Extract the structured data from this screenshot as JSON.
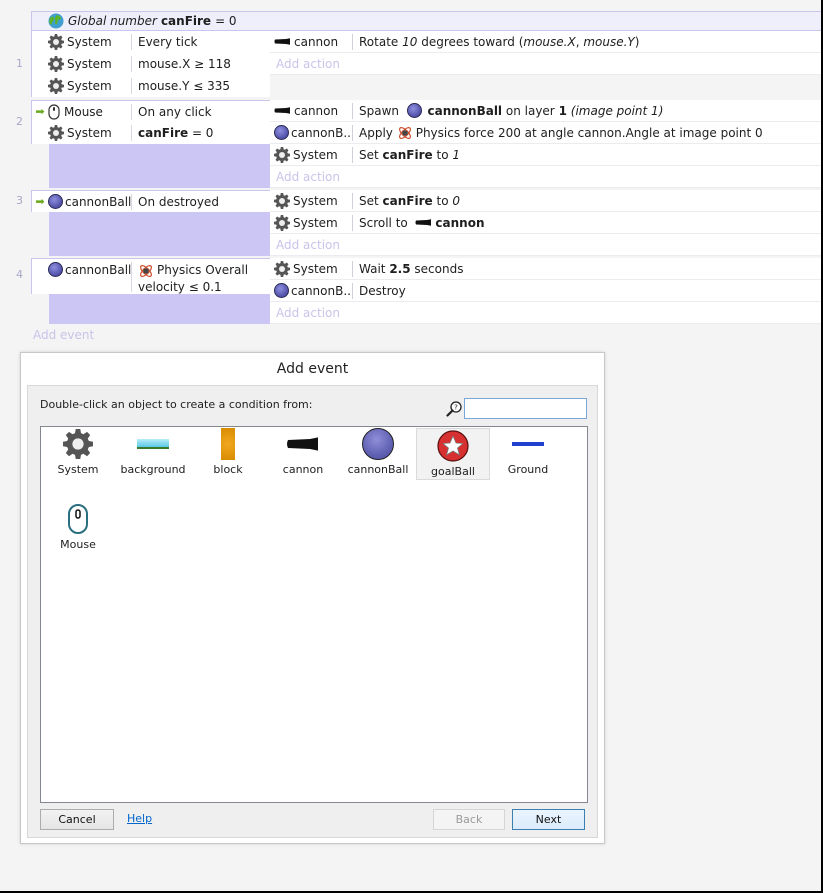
{
  "event_sheet": {
    "global_variable": {
      "prefix": "Global number",
      "name": "canFire",
      "suffix": "= 0",
      "icon": "globe-icon"
    },
    "events": [
      {
        "number": "1",
        "trigger": false,
        "conditions": [
          {
            "object": "System",
            "icon": "gear-icon",
            "text": "Every tick"
          },
          {
            "object": "System",
            "icon": "gear-icon",
            "text": "mouse.X ≥ 118"
          },
          {
            "object": "System",
            "icon": "gear-icon",
            "text": "mouse.Y ≤ 335"
          }
        ],
        "actions": [
          {
            "object": "cannon",
            "icon": "cannon-icon",
            "parts": [
              "Rotate ",
              "10",
              " degrees toward (",
              "mouse.X",
              ", ",
              "mouse.Y",
              ")"
            ]
          }
        ],
        "add_action": "Add action"
      },
      {
        "number": "2",
        "trigger": true,
        "conditions": [
          {
            "object": "Mouse",
            "icon": "mouse-icon",
            "text": "On any click"
          },
          {
            "object": "System",
            "icon": "gear-icon",
            "bold": "canFire",
            "text": " = 0"
          }
        ],
        "actions": [
          {
            "object": "cannon",
            "icon": "cannon-icon",
            "verb": "Spawn",
            "target": "cannonBall",
            "mid": "on layer",
            "layer": "1",
            "tail": "(image point 1)"
          },
          {
            "object": "cannonB...",
            "icon": "cannonball-icon",
            "verb": "Apply",
            "text": "Physics force 200 at angle cannon.Angle at image point 0"
          },
          {
            "object": "System",
            "icon": "gear-icon",
            "verb": "Set",
            "var": "canFire",
            "mid": "to",
            "value": "1"
          }
        ],
        "add_action": "Add action"
      },
      {
        "number": "3",
        "trigger": true,
        "conditions": [
          {
            "object": "cannonBall",
            "icon": "cannonball-icon",
            "text": "On destroyed"
          }
        ],
        "actions": [
          {
            "object": "System",
            "icon": "gear-icon",
            "verb": "Set",
            "var": "canFire",
            "mid": "to",
            "value": "0"
          },
          {
            "object": "System",
            "icon": "gear-icon",
            "verb": "Scroll to",
            "target": "cannon"
          }
        ],
        "add_action": "Add action"
      },
      {
        "number": "4",
        "trigger": false,
        "conditions": [
          {
            "object": "cannonBall",
            "icon": "cannonball-icon",
            "text": "Physics Overall velocity ≤ 0.1"
          }
        ],
        "actions": [
          {
            "object": "System",
            "icon": "gear-icon",
            "verb": "Wait",
            "value": "2.5",
            "tail": "seconds"
          },
          {
            "object": "cannonB...",
            "icon": "cannonball-icon",
            "text": "Destroy"
          }
        ],
        "add_action": "Add action"
      }
    ],
    "add_event": "Add event"
  },
  "dialog": {
    "title": "Add event",
    "hint": "Double-click an object to create a condition from:",
    "search_value": "",
    "objects": [
      {
        "label": "System",
        "icon": "gear-icon",
        "selected": false
      },
      {
        "label": "background",
        "icon": "background-icon",
        "selected": false
      },
      {
        "label": "block",
        "icon": "block-icon",
        "selected": false
      },
      {
        "label": "cannon",
        "icon": "cannon-icon",
        "selected": false
      },
      {
        "label": "cannonBall",
        "icon": "cannonball-icon",
        "selected": false
      },
      {
        "label": "goalBall",
        "icon": "goalball-icon",
        "selected": true
      },
      {
        "label": "Ground",
        "icon": "ground-icon",
        "selected": false
      },
      {
        "label": "Mouse",
        "icon": "mouse-icon",
        "selected": false
      }
    ],
    "buttons": {
      "cancel": "Cancel",
      "help": "Help",
      "back": "Back",
      "next": "Next"
    }
  },
  "colors": {
    "condition_block": "#ccc6f5",
    "add_text": "#c8c4ea",
    "link": "#0066cc"
  }
}
